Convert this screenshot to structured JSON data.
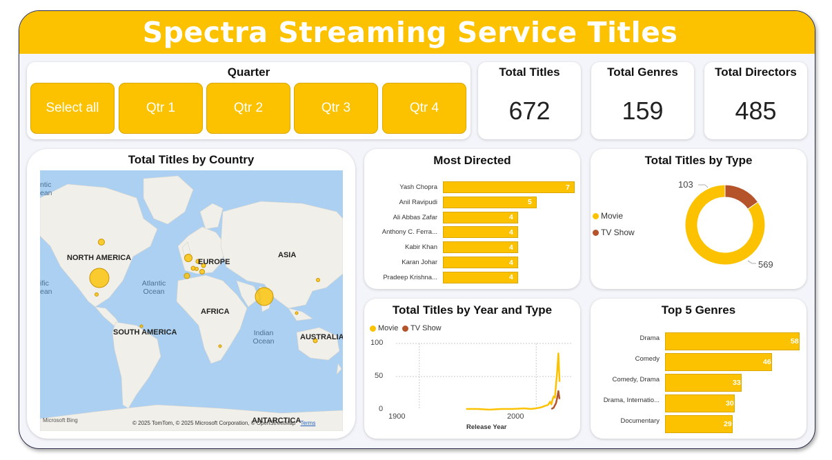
{
  "header": {
    "title": "Spectra Streaming Service Titles"
  },
  "slicer": {
    "title": "Quarter",
    "options": [
      "Select all",
      "Qtr 1",
      "Qtr 2",
      "Qtr 3",
      "Qtr 4"
    ]
  },
  "kpis": [
    {
      "label": "Total Titles",
      "value": "672"
    },
    {
      "label": "Total Genres",
      "value": "159"
    },
    {
      "label": "Total Directors",
      "value": "485"
    }
  ],
  "map": {
    "title": "Total Titles by Country",
    "continents": [
      "NORTH AMERICA",
      "EUROPE",
      "ASIA",
      "AFRICA",
      "SOUTH AMERICA",
      "AUSTRALIA",
      "ANTARCTICA"
    ],
    "oceans": [
      "Atlantic Ocean",
      "Indian Ocean",
      "Pacific Ocean",
      "Pacific Ocean"
    ],
    "ocean_edge_left": [
      "ntic",
      "ean"
    ],
    "ocean_edge_left2": [
      "ific",
      "ean"
    ],
    "attribution": "© 2025 TomTom, © 2025 Microsoft Corporation, © OpenStreetMap",
    "terms": "Terms",
    "bing": "Microsoft Bing"
  },
  "most_directed": {
    "title": "Most Directed",
    "rows": [
      {
        "name": "Yash Chopra",
        "value": 7
      },
      {
        "name": "Anil Ravipudi",
        "value": 5
      },
      {
        "name": "Ali Abbas Zafar",
        "value": 4
      },
      {
        "name": "Anthony C. Ferra...",
        "value": 4
      },
      {
        "name": "Kabir Khan",
        "value": 4
      },
      {
        "name": "Karan Johar",
        "value": 4
      },
      {
        "name": "Pradeep Krishna...",
        "value": 4
      }
    ]
  },
  "titles_by_type": {
    "title": "Total Titles by Type",
    "legend": [
      "Movie",
      "TV Show"
    ],
    "slices": [
      {
        "name": "Movie",
        "value": 569
      },
      {
        "name": "TV Show",
        "value": 103
      }
    ]
  },
  "year_type": {
    "title": "Total Titles by Year and Type",
    "legend": [
      "Movie",
      "TV Show"
    ],
    "xlabel": "Release Year",
    "yticks": [
      "100",
      "50",
      "0"
    ],
    "xticks": [
      "1900",
      "2000"
    ]
  },
  "top_genres": {
    "title": "Top 5 Genres",
    "rows": [
      {
        "name": "Drama",
        "value": 58
      },
      {
        "name": "Comedy",
        "value": 46
      },
      {
        "name": "Comedy, Drama",
        "value": 33
      },
      {
        "name": "Drama, Internatio...",
        "value": 30
      },
      {
        "name": "Documentary",
        "value": 29
      }
    ]
  },
  "colors": {
    "accent": "#fcc200",
    "tvshow": "#b5532a",
    "map_water": "#abd0f1",
    "map_land": "#f1efe9"
  },
  "chart_data": [
    {
      "type": "bar",
      "title": "Most Directed",
      "categories": [
        "Yash Chopra",
        "Anil Ravipudi",
        "Ali Abbas Zafar",
        "Anthony C. Ferra...",
        "Kabir Khan",
        "Karan Johar",
        "Pradeep Krishna..."
      ],
      "values": [
        7,
        5,
        4,
        4,
        4,
        4,
        4
      ]
    },
    {
      "type": "pie",
      "title": "Total Titles by Type",
      "categories": [
        "Movie",
        "TV Show"
      ],
      "values": [
        569,
        103
      ]
    },
    {
      "type": "line",
      "title": "Total Titles by Year and Type",
      "xlabel": "Release Year",
      "xlim": [
        1880,
        2030
      ],
      "ylim": [
        0,
        100
      ],
      "series": [
        {
          "name": "Movie",
          "x": [
            1940,
            1950,
            1960,
            1970,
            1980,
            1990,
            1995,
            2000,
            2003,
            2005,
            2008,
            2010,
            2012,
            2013,
            2014,
            2015,
            2016,
            2017,
            2018,
            2019,
            2020
          ],
          "values": [
            1,
            1,
            0,
            1,
            1,
            2,
            1,
            2,
            3,
            4,
            6,
            7,
            12,
            8,
            15,
            20,
            18,
            38,
            58,
            85,
            42
          ]
        },
        {
          "name": "TV Show",
          "x": [
            2013,
            2015,
            2017,
            2018,
            2019,
            2020
          ],
          "values": [
            1,
            3,
            10,
            18,
            28,
            16
          ]
        }
      ]
    },
    {
      "type": "bar",
      "title": "Top 5 Genres",
      "categories": [
        "Drama",
        "Comedy",
        "Comedy, Drama",
        "Drama, Internatio...",
        "Documentary"
      ],
      "values": [
        58,
        46,
        33,
        30,
        29
      ]
    }
  ]
}
